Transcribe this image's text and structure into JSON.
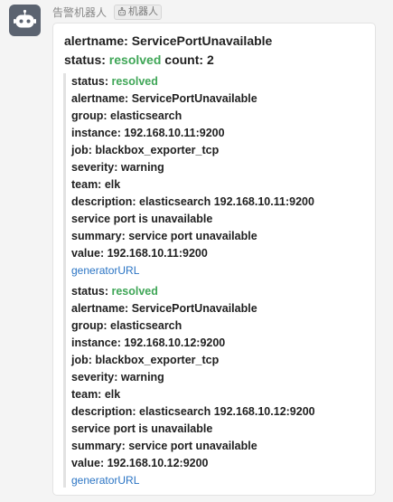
{
  "sender": {
    "name": "告警机器人",
    "badge": "机器人",
    "avatar_icon": "robot-icon"
  },
  "message": {
    "title_line": "alertname: ServicePortUnavailable",
    "status_label": "status:",
    "status_value": "resolved",
    "count_label": "count:",
    "count_value": "2",
    "alerts": [
      {
        "status_label": "status:",
        "status_value": "resolved",
        "alertname": "alertname: ServicePortUnavailable",
        "group": "group: elasticsearch",
        "instance": "instance: 192.168.10.11:9200",
        "job": "job: blackbox_exporter_tcp",
        "severity": "severity: warning",
        "team": "team: elk",
        "description_1": "description: elasticsearch 192.168.10.11:9200",
        "description_2": "service port is unavailable",
        "summary": "summary: service port unavailable",
        "value": "value: 192.168.10.11:9200",
        "link": "generatorURL"
      },
      {
        "status_label": "status:",
        "status_value": "resolved",
        "alertname": "alertname: ServicePortUnavailable",
        "group": "group: elasticsearch",
        "instance": "instance: 192.168.10.12:9200",
        "job": "job: blackbox_exporter_tcp",
        "severity": "severity: warning",
        "team": "team: elk",
        "description_1": "description: elasticsearch 192.168.10.12:9200",
        "description_2": "service port is unavailable",
        "summary": "summary: service port unavailable",
        "value": "value: 192.168.10.12:9200",
        "link": "generatorURL"
      }
    ]
  },
  "colors": {
    "resolved": "#3fa657",
    "link": "#2a74c4",
    "avatar_bg": "#5b6370"
  }
}
